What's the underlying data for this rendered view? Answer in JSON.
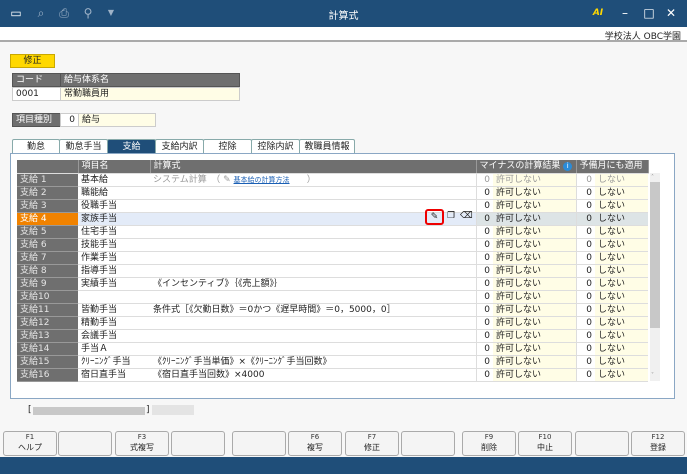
{
  "window": {
    "title": "計算式",
    "company": "学校法人 OBC学園"
  },
  "mode": "修正",
  "code_table": {
    "headers": [
      "コード",
      "給与体系名"
    ],
    "code": "0001",
    "name": "常勤職員用"
  },
  "item_type": {
    "label": "項目種別",
    "code": "0",
    "value": "給与"
  },
  "tabs": [
    "勤怠",
    "勤怠手当",
    "支給",
    "支給内訳",
    "控除",
    "控除内訳",
    "教職員情報"
  ],
  "active_tab": "支給",
  "grid": {
    "headers": {
      "name": "項目名",
      "formula": "計算式",
      "minus": "マイナスの計算結果",
      "yobi": "予備月にも適用"
    },
    "system_calc": "システム計算　（",
    "system_link": "基本給の計算方法",
    "system_close": "）",
    "rows": [
      {
        "label": "支給 1",
        "name": "基本給",
        "formula": "",
        "mc": "0",
        "mv": "許可しない",
        "yc": "0",
        "yv": "しない"
      },
      {
        "label": "支給 2",
        "name": "職能給",
        "formula": "",
        "mc": "0",
        "mv": "許可しない",
        "yc": "0",
        "yv": "しない"
      },
      {
        "label": "支給 3",
        "name": "役職手当",
        "formula": "",
        "mc": "0",
        "mv": "許可しない",
        "yc": "0",
        "yv": "しない"
      },
      {
        "label": "支給 4",
        "name": "家族手当",
        "formula": "",
        "mc": "0",
        "mv": "許可しない",
        "yc": "0",
        "yv": "しない"
      },
      {
        "label": "支給 5",
        "name": "住宅手当",
        "formula": "",
        "mc": "0",
        "mv": "許可しない",
        "yc": "0",
        "yv": "しない"
      },
      {
        "label": "支給 6",
        "name": "技能手当",
        "formula": "",
        "mc": "0",
        "mv": "許可しない",
        "yc": "0",
        "yv": "しない"
      },
      {
        "label": "支給 7",
        "name": "作業手当",
        "formula": "",
        "mc": "0",
        "mv": "許可しない",
        "yc": "0",
        "yv": "しない"
      },
      {
        "label": "支給 8",
        "name": "指導手当",
        "formula": "",
        "mc": "0",
        "mv": "許可しない",
        "yc": "0",
        "yv": "しない"
      },
      {
        "label": "支給 9",
        "name": "実績手当",
        "formula": "《インセンティブ》｛《売上額》｝",
        "mc": "0",
        "mv": "許可しない",
        "yc": "0",
        "yv": "しない"
      },
      {
        "label": "支給10",
        "name": "",
        "formula": "",
        "mc": "0",
        "mv": "許可しない",
        "yc": "0",
        "yv": "しない"
      },
      {
        "label": "支給11",
        "name": "皆勤手当",
        "formula": "条件式［《欠勤日数》＝0かつ《遅早時間》＝0，5000，0］",
        "mc": "0",
        "mv": "許可しない",
        "yc": "0",
        "yv": "しない"
      },
      {
        "label": "支給12",
        "name": "精勤手当",
        "formula": "",
        "mc": "0",
        "mv": "許可しない",
        "yc": "0",
        "yv": "しない"
      },
      {
        "label": "支給13",
        "name": "会議手当",
        "formula": "",
        "mc": "0",
        "mv": "許可しない",
        "yc": "0",
        "yv": "しない"
      },
      {
        "label": "支給14",
        "name": "手当Ａ",
        "formula": "",
        "mc": "0",
        "mv": "許可しない",
        "yc": "0",
        "yv": "しない"
      },
      {
        "label": "支給15",
        "name": "ｸﾘｰﾆﾝｸﾞ手当",
        "formula": "《ｸﾘｰﾆﾝｸﾞ手当単価》×《ｸﾘｰﾆﾝｸﾞ手当回数》",
        "mc": "0",
        "mv": "許可しない",
        "yc": "0",
        "yv": "しない"
      },
      {
        "label": "支給16",
        "name": "宿日直手当",
        "formula": "《宿日直手当回数》×4000",
        "mc": "0",
        "mv": "許可しない",
        "yc": "0",
        "yv": "しない"
      }
    ]
  },
  "status": {
    "open": "[",
    "close": "]"
  },
  "fkeys": [
    {
      "key": "F1",
      "label": "ヘルプ"
    },
    {
      "key": "",
      "label": ""
    },
    {
      "key": "F3",
      "label": "式複写"
    },
    {
      "key": "",
      "label": ""
    },
    {
      "key": "",
      "label": ""
    },
    {
      "key": "F6",
      "label": "複写"
    },
    {
      "key": "F7",
      "label": "修正"
    },
    {
      "key": "",
      "label": ""
    },
    {
      "key": "F9",
      "label": "削除"
    },
    {
      "key": "F10",
      "label": "中止"
    },
    {
      "key": "",
      "label": ""
    },
    {
      "key": "F12",
      "label": "登録"
    }
  ],
  "colors": {
    "titlebar": "#1f4e79",
    "selected_row": "#f08200",
    "mode": "#ffd800"
  }
}
